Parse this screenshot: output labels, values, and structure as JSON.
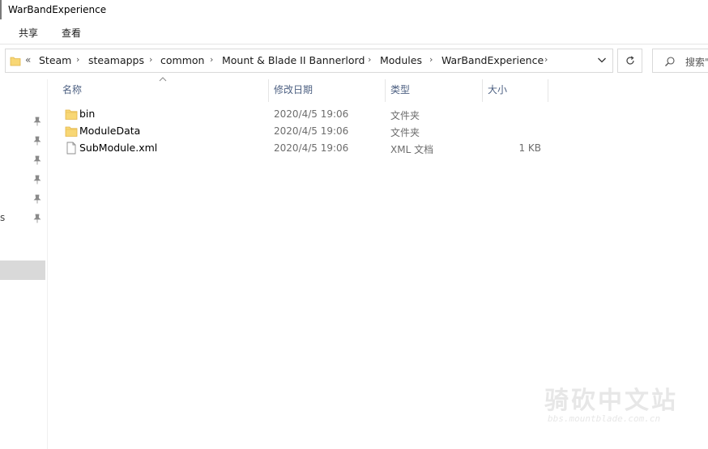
{
  "window": {
    "title": "WarBandExperience"
  },
  "ribbon": {
    "tabs": [
      "共享",
      "查看"
    ]
  },
  "address": {
    "overflow": "«",
    "crumbs": [
      "Steam",
      "steamapps",
      "common",
      "Mount & Blade II Bannerlord",
      "Modules",
      "WarBandExperience"
    ],
    "separator": "›"
  },
  "search": {
    "placeholder": "搜索\""
  },
  "nav": {
    "edge_text": "s"
  },
  "columns": {
    "name": "名称",
    "date": "修改日期",
    "type": "类型",
    "size": "大小"
  },
  "files": [
    {
      "icon": "folder-icon",
      "name": "bin",
      "date": "2020/4/5 19:06",
      "type": "文件夹",
      "size": ""
    },
    {
      "icon": "folder-icon",
      "name": "ModuleData",
      "date": "2020/4/5 19:06",
      "type": "文件夹",
      "size": ""
    },
    {
      "icon": "file-icon",
      "name": "SubModule.xml",
      "date": "2020/4/5 19:06",
      "type": "XML 文档",
      "size": "1 KB"
    }
  ],
  "watermark": {
    "main": "骑砍中文站",
    "sub": "bbs.mountblade.com.cn"
  },
  "colors": {
    "folder": "#f8d775",
    "folder_dark": "#e8b84a",
    "header_text": "#4d6082",
    "selection": "#d9d9d9"
  }
}
